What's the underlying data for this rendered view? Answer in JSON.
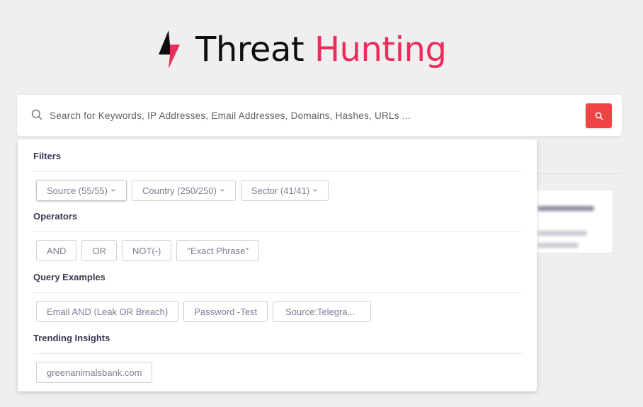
{
  "logo": {
    "icon": "lightning-bolt-icon",
    "title_part1": "Threat",
    "title_part2": "Hunting",
    "colors": {
      "dark": "#0e0e0e",
      "accent": "#ef2b5c"
    }
  },
  "search": {
    "placeholder": "Search for Keywords, IP Addresses, Email Addresses, Domains, Hashes, URLs ...",
    "value": "",
    "icon": "search-icon",
    "button_icon": "search-icon",
    "button_color": "#ef4444"
  },
  "dropdown": {
    "sections": [
      {
        "title": "Filters",
        "chips": [
          {
            "label": "Source (55/55)",
            "has_chevron": true,
            "active": true
          },
          {
            "label": "Country (250/250)",
            "has_chevron": true
          },
          {
            "label": "Sector (41/41)",
            "has_chevron": true
          }
        ]
      },
      {
        "title": "Operators",
        "chips": [
          {
            "label": "AND"
          },
          {
            "label": "OR"
          },
          {
            "label": "NOT(-)"
          },
          {
            "label": "\"Exact Phrase\""
          }
        ]
      },
      {
        "title": "Query Examples",
        "chips": [
          {
            "label": "Email AND (Leak OR Breach)"
          },
          {
            "label": "Password -Test"
          },
          {
            "label": "Source:Telegra..."
          }
        ]
      },
      {
        "title": "Trending Insights",
        "chips": [
          {
            "label": "greenanimalsbank.com"
          }
        ]
      }
    ]
  }
}
